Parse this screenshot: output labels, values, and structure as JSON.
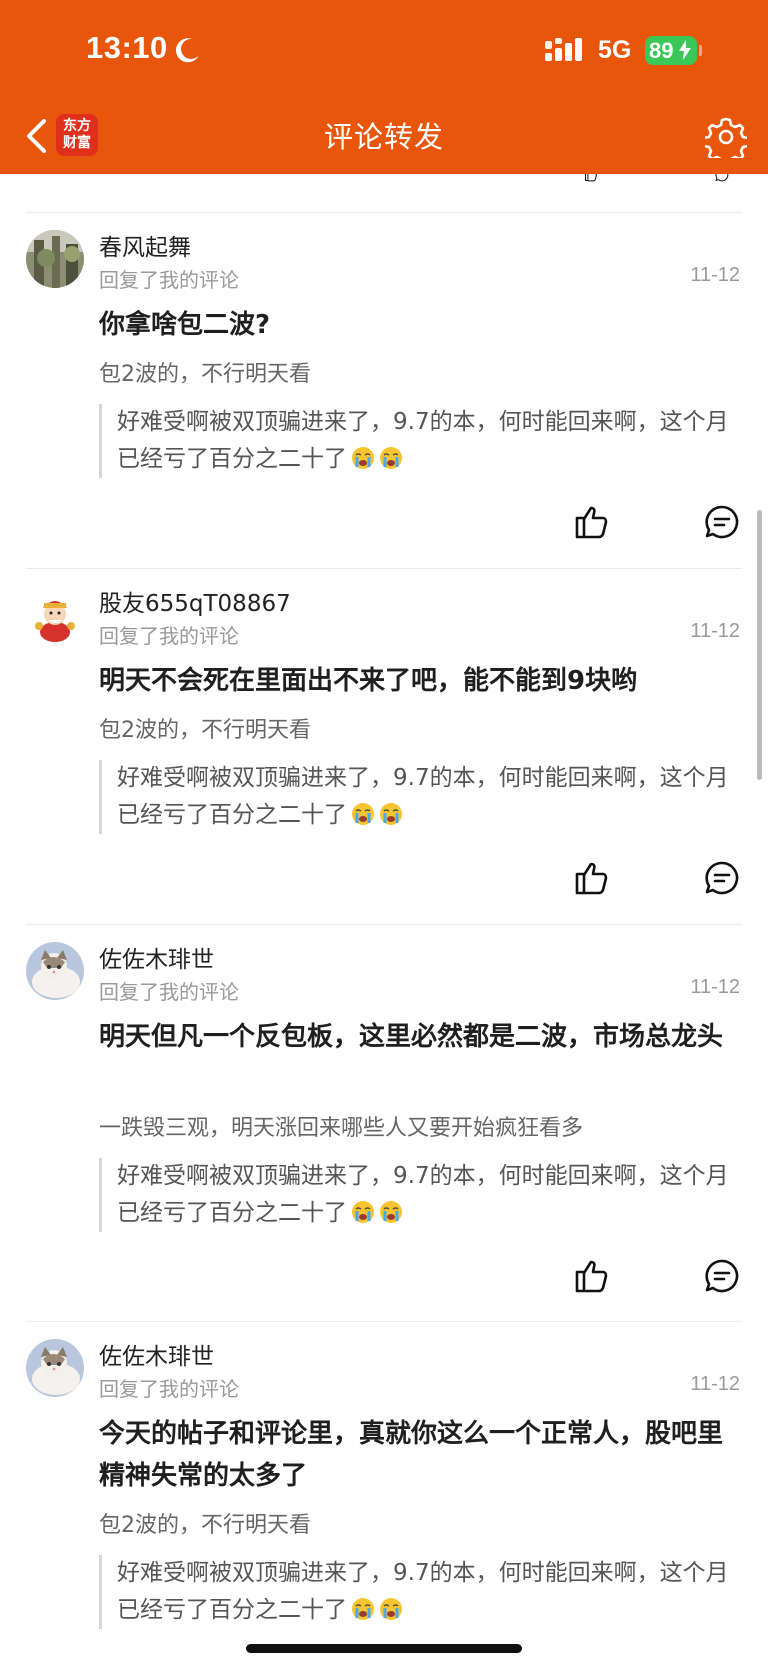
{
  "status": {
    "time": "13:10",
    "network": "5G",
    "battery": "89"
  },
  "header": {
    "title": "评论转发",
    "logo_line1": "东方",
    "logo_line2": "财富"
  },
  "comments": [
    {
      "user": "春风起舞",
      "subtitle": "回复了我的评论",
      "date": "11-12",
      "text": "你拿啥包二波?",
      "my_comment": "包2波的，不行明天看",
      "quoted": "好难受啊被双顶骗进来了，9.7的本，何时能回来啊，这个月已经亏了百分之二十了"
    },
    {
      "user": "股友655qT08867",
      "subtitle": "回复了我的评论",
      "date": "11-12",
      "text": "明天不会死在里面出不来了吧，能不能到9块哟",
      "my_comment": "包2波的，不行明天看",
      "quoted": "好难受啊被双顶骗进来了，9.7的本，何时能回来啊，这个月已经亏了百分之二十了"
    },
    {
      "user": "佐佐木琲世",
      "subtitle": "回复了我的评论",
      "date": "11-12",
      "text": "明天但凡一个反包板，这里必然都是二波，市场总龙头",
      "my_comment": "一跌毁三观，明天涨回来哪些人又要开始疯狂看多",
      "quoted": "好难受啊被双顶骗进来了，9.7的本，何时能回来啊，这个月已经亏了百分之二十了"
    },
    {
      "user": "佐佐木琲世",
      "subtitle": "回复了我的评论",
      "date": "11-12",
      "text": "今天的帖子和评论里，真就你这么一个正常人，股吧里精神失常的太多了",
      "my_comment": "包2波的，不行明天看",
      "quoted": "好难受啊被双顶骗进来了，9.7的本，何时能回来啊，这个月已经亏了百分之二十了"
    }
  ],
  "colors": {
    "header": "#E8560C",
    "battery": "#39C758",
    "logo": "#E02F1B"
  },
  "icons": [
    "back-icon",
    "gear-icon",
    "thumbs-up-icon",
    "comment-icon",
    "crying-emoji-icon"
  ]
}
